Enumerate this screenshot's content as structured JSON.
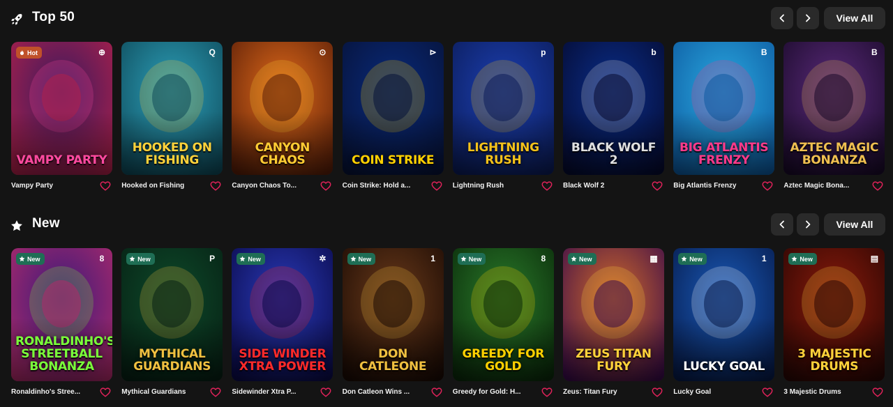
{
  "sections": [
    {
      "title": "Top 50",
      "icon": "rocket-icon",
      "view_all_label": "View All",
      "games": [
        {
          "name": "Vampy Party",
          "art_title": "Vampy Party",
          "badge": "Hot",
          "provider_mark": "⊕",
          "colors": [
            "#3a1a5e",
            "#b0204a"
          ],
          "accent": "#ff4aa0"
        },
        {
          "name": "Hooked on Fishing",
          "art_title": "Hooked on Fishing",
          "badge": "",
          "provider_mark": "Q",
          "colors": [
            "#2d9fb8",
            "#0e4a5a"
          ],
          "accent": "#ffd23a"
        },
        {
          "name": "Canyon Chaos To...",
          "art_title": "Canyon Chaos",
          "badge": "",
          "provider_mark": "⊙",
          "colors": [
            "#e06a1a",
            "#5a1e08"
          ],
          "accent": "#ffcc33"
        },
        {
          "name": "Coin Strike: Hold a...",
          "art_title": "Coin Strike",
          "badge": "",
          "provider_mark": "⊳",
          "colors": [
            "#0a2a7a",
            "#061238"
          ],
          "accent": "#ffd000"
        },
        {
          "name": "Lightning Rush",
          "art_title": "Lightning Rush",
          "badge": "",
          "provider_mark": "p",
          "colors": [
            "#1c3fb0",
            "#0b1c5a"
          ],
          "accent": "#f5c21a"
        },
        {
          "name": "Black Wolf 2",
          "art_title": "Black Wolf 2",
          "badge": "",
          "provider_mark": "b",
          "colors": [
            "#0a2e8a",
            "#050a30"
          ],
          "accent": "#e0e0e0"
        },
        {
          "name": "Big Atlantis Frenzy",
          "art_title": "Big Atlantis Frenzy",
          "badge": "",
          "provider_mark": "B",
          "colors": [
            "#2aa8e0",
            "#0d5aa0"
          ],
          "accent": "#ff3a8a"
        },
        {
          "name": "Aztec Magic Bona...",
          "art_title": "Aztec Magic Bonanza",
          "badge": "",
          "provider_mark": "B",
          "colors": [
            "#5a2a7a",
            "#1a0a2a"
          ],
          "accent": "#f0c050"
        }
      ]
    },
    {
      "title": "New",
      "icon": "star-icon",
      "view_all_label": "View All",
      "games": [
        {
          "name": "Ronaldinho's Stree...",
          "art_title": "Ronaldinho's Streetball Bonanza",
          "badge": "New",
          "provider_mark": "8",
          "colors": [
            "#3a1a7a",
            "#b02a6a"
          ],
          "accent": "#7aff3a"
        },
        {
          "name": "Mythical Guardians",
          "art_title": "Mythical Guardians",
          "badge": "New",
          "provider_mark": "P",
          "colors": [
            "#0e4a2a",
            "#062014"
          ],
          "accent": "#f0c040"
        },
        {
          "name": "Sidewinder Xtra P...",
          "art_title": "Side Winder Xtra Power",
          "badge": "New",
          "provider_mark": "✲",
          "colors": [
            "#2a3ab8",
            "#0a0a4a"
          ],
          "accent": "#ff2a2a"
        },
        {
          "name": "Don Catleon Wins ...",
          "art_title": "Don Catleone",
          "badge": "New",
          "provider_mark": "1",
          "colors": [
            "#6a3a1a",
            "#1a0a04"
          ],
          "accent": "#f0c040"
        },
        {
          "name": "Greedy for Gold: H...",
          "art_title": "Greedy for Gold",
          "badge": "New",
          "provider_mark": "8",
          "colors": [
            "#2a7a2a",
            "#0a2a0a"
          ],
          "accent": "#ffd000"
        },
        {
          "name": "Zeus: Titan Fury",
          "art_title": "Zeus Titan Fury",
          "badge": "New",
          "provider_mark": "▦",
          "colors": [
            "#d06a2a",
            "#3a0a4a"
          ],
          "accent": "#ffd23a"
        },
        {
          "name": "Lucky Goal",
          "art_title": "Lucky Goal",
          "badge": "New",
          "provider_mark": "1",
          "colors": [
            "#1a5ab8",
            "#061a4a"
          ],
          "accent": "#ffffff"
        },
        {
          "name": "3 Majestic Drums",
          "art_title": "3 Majestic Drums",
          "badge": "New",
          "provider_mark": "▤",
          "colors": [
            "#8a1a0a",
            "#2a0604"
          ],
          "accent": "#ffd23a"
        }
      ]
    }
  ],
  "colors": {
    "background": "#141414",
    "button_bg": "#2a2a2a",
    "heart": "#e0225a"
  }
}
